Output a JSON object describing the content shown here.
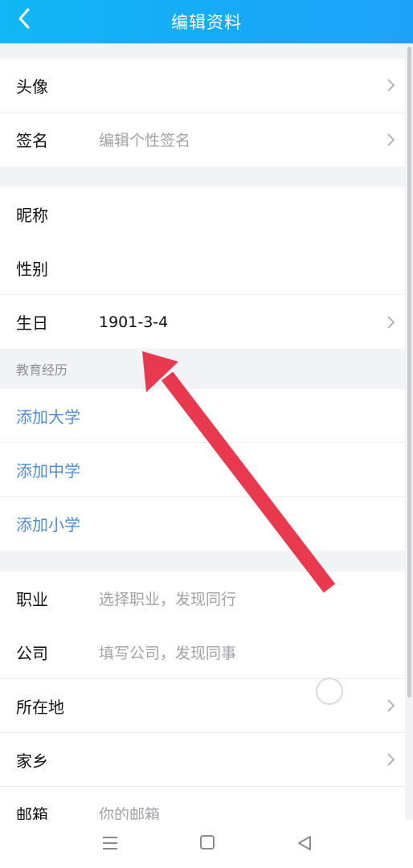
{
  "header": {
    "title": "编辑资料",
    "back_icon": "chevron-left-icon"
  },
  "basic": {
    "avatar_label": "头像",
    "signature_label": "签名",
    "signature_placeholder": "编辑个性签名"
  },
  "personal": {
    "nickname_label": "昵称",
    "gender_label": "性别",
    "birthday_label": "生日",
    "birthday_value": "1901-3-4"
  },
  "education": {
    "section_title": "教育经历",
    "add_university": "添加大学",
    "add_middle_school": "添加中学",
    "add_primary_school": "添加小学"
  },
  "work": {
    "job_label": "职业",
    "job_placeholder": "选择职业，发现同行",
    "company_label": "公司",
    "company_placeholder": "填写公司，发现同事",
    "location_label": "所在地",
    "hometown_label": "家乡",
    "email_label": "邮箱",
    "email_placeholder": "你的邮箱"
  },
  "colors": {
    "header_bg": "#17a9f7",
    "link_blue": "#4f8fcf",
    "annotation_arrow": "#e8394f"
  },
  "navbar": {
    "icons": [
      "menu-icon",
      "home-square-icon",
      "back-triangle-icon"
    ]
  }
}
